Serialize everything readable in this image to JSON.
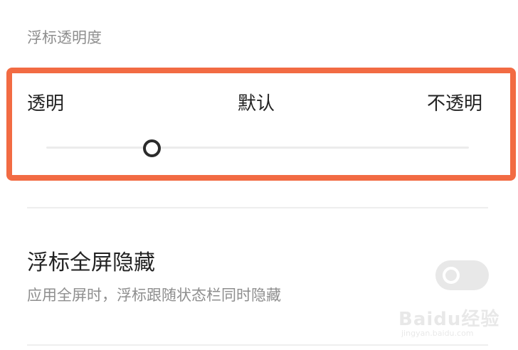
{
  "opacity_section": {
    "title": "浮标透明度",
    "slider": {
      "left_label": "透明",
      "center_label": "默认",
      "right_label": "不透明",
      "value_fraction": 0.25
    },
    "highlight_color": "#f26b43"
  },
  "fullscreen_setting": {
    "title": "浮标全屏隐藏",
    "description": "应用全屏时，浮标跟随状态栏同时隐藏",
    "toggle_on": false
  },
  "watermark": {
    "brand": "Baidu经验",
    "url": "jingyan.baidu.com"
  }
}
